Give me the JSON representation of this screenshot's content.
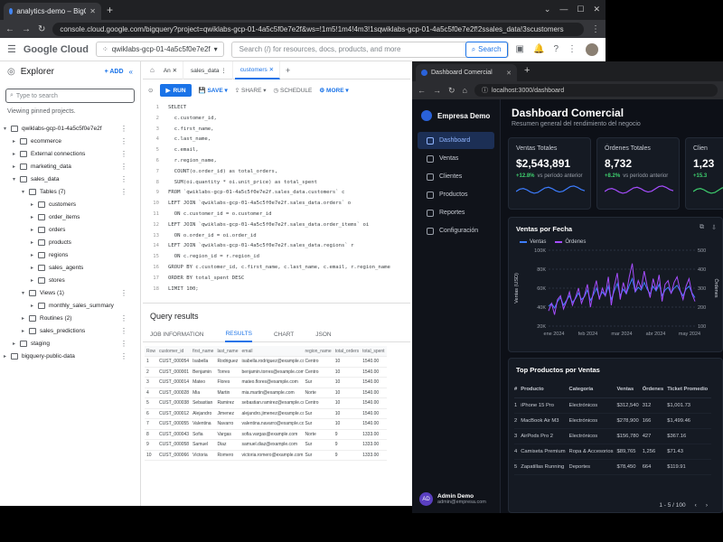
{
  "bq": {
    "tab_title": "analytics-demo – BigQuery – qwikl",
    "url": "console.cloud.google.com/bigquery?project=qwiklabs-gcp-01-4a5c5f0e7e2f&ws=!1m5!1m4!4m3!1sqwiklabs-gcp-01-4a5c5f0e7e2f!2ssales_data!3scustomers",
    "brand": "Google Cloud",
    "project": "qwiklabs-gcp-01-4a5c5f0e7e2f",
    "search_placeholder": "Search (/) for resources, docs, products, and more",
    "search_button": "Search",
    "explorer": {
      "title": "Explorer",
      "add": "+ ADD",
      "search_placeholder": "Type to search",
      "pinned": "Viewing pinned projects.",
      "tree": [
        {
          "label": "qwiklabs-gcp-01-4a5c5f0e7e2f",
          "indent": 0,
          "arrow": "▾"
        },
        {
          "label": "ecommerce",
          "indent": 1,
          "arrow": "▸"
        },
        {
          "label": "External connections",
          "indent": 1,
          "arrow": "▸"
        },
        {
          "label": "marketing_data",
          "indent": 1,
          "arrow": "▸"
        },
        {
          "label": "sales_data",
          "indent": 1,
          "arrow": "▾"
        },
        {
          "label": "Tables (7)",
          "indent": 2,
          "arrow": "▾"
        },
        {
          "label": "customers",
          "indent": 3,
          "arrow": "▸"
        },
        {
          "label": "order_items",
          "indent": 3,
          "arrow": "▸"
        },
        {
          "label": "orders",
          "indent": 3,
          "arrow": "▸"
        },
        {
          "label": "products",
          "indent": 3,
          "arrow": "▸"
        },
        {
          "label": "regions",
          "indent": 3,
          "arrow": "▸"
        },
        {
          "label": "sales_agents",
          "indent": 3,
          "arrow": "▸"
        },
        {
          "label": "stores",
          "indent": 3,
          "arrow": "▸"
        },
        {
          "label": "Views (1)",
          "indent": 2,
          "arrow": "▾"
        },
        {
          "label": "monthly_sales_summary",
          "indent": 3,
          "arrow": "▸"
        },
        {
          "label": "Routines (2)",
          "indent": 2,
          "arrow": "▸"
        },
        {
          "label": "sales_predictions",
          "indent": 2,
          "arrow": "▸"
        },
        {
          "label": "staging",
          "indent": 1,
          "arrow": "▸"
        },
        {
          "label": "bigquery-public-data",
          "indent": 0,
          "arrow": "▸"
        }
      ]
    },
    "editor_tabs": [
      {
        "label": "An ✕",
        "active": false
      },
      {
        "label": "sales_data ⋮",
        "active": false
      },
      {
        "label": "customers ✕",
        "active": true
      }
    ],
    "toolbar": {
      "run": "RUN",
      "save": "SAVE",
      "share": "SHARE",
      "schedule": "SCHEDULE",
      "more": "MORE"
    },
    "code_lines": [
      "SELECT",
      "  c.customer_id,",
      "  c.first_name,",
      "  c.last_name,",
      "  c.email,",
      "  r.region_name,",
      "  COUNT(o.order_id) as total_orders,",
      "  SUM(oi.quantity * oi.unit_price) as total_spent",
      "FROM `qwiklabs-gcp-01-4a5c5f0e7e2f.sales_data.customers` c",
      "LEFT JOIN `qwiklabs-gcp-01-4a5c5f0e7e2f.sales_data.orders` o",
      "  ON c.customer_id = o.customer_id",
      "LEFT JOIN `qwiklabs-gcp-01-4a5c5f0e7e2f.sales_data.order_items` oi",
      "  ON o.order_id = oi.order_id",
      "LEFT JOIN `qwiklabs-gcp-01-4a5c5f0e7e2f.sales_data.regions` r",
      "  ON c.region_id = r.region_id",
      "GROUP BY c.customer_id, c.first_name, c.last_name, c.email, r.region_name",
      "ORDER BY total_spent DESC",
      "LIMIT 100;"
    ],
    "results": {
      "title": "Query results",
      "tabs": [
        "JOB INFORMATION",
        "RESULTS",
        "CHART",
        "JSON"
      ],
      "active_tab": 1,
      "columns": [
        "Row",
        "customer_id",
        "first_name",
        "last_name",
        "email",
        "region_name",
        "total_orders",
        "total_spent"
      ],
      "rows": [
        [
          "1",
          "CUST_000054",
          "Isabella",
          "Rodriguez",
          "isabella.rodriguez@example.com",
          "Centro",
          "10",
          "1540.00"
        ],
        [
          "2",
          "CUST_000001",
          "Benjamin",
          "Torres",
          "benjamin.torres@example.com",
          "Centro",
          "10",
          "1540.00"
        ],
        [
          "3",
          "CUST_000014",
          "Mateo",
          "Flores",
          "mateo.flores@example.com",
          "Sur",
          "10",
          "1540.00"
        ],
        [
          "4",
          "CUST_000028",
          "Mia",
          "Martin",
          "mia.martin@example.com",
          "Norte",
          "10",
          "1540.00"
        ],
        [
          "5",
          "CUST_000038",
          "Sebastian",
          "Ramirez",
          "sebastian.ramirez@example.com",
          "Centro",
          "10",
          "1540.00"
        ],
        [
          "6",
          "CUST_000012",
          "Alejandro",
          "Jimenez",
          "alejandro.jimenez@example.com",
          "Sur",
          "10",
          "1540.00"
        ],
        [
          "7",
          "CUST_000055",
          "Valentina",
          "Navarro",
          "valentina.navarro@example.com",
          "Sur",
          "10",
          "1540.00"
        ],
        [
          "8",
          "CUST_000043",
          "Sofia",
          "Vargas",
          "sofia.vargas@example.com",
          "Norte",
          "9",
          "1333.00"
        ],
        [
          "9",
          "CUST_000058",
          "Samuel",
          "Diaz",
          "samuel.diaz@example.com",
          "Sur",
          "9",
          "1333.00"
        ],
        [
          "10",
          "CUST_000066",
          "Victoria",
          "Romero",
          "victoria.romero@example.com",
          "Sur",
          "9",
          "1333.00"
        ]
      ]
    }
  },
  "dash": {
    "tab_title": "Dashboard Comercial",
    "url": "localhost:3000/dashboard",
    "brand": "Empresa Demo",
    "nav": [
      "Dashboard",
      "Ventas",
      "Clientes",
      "Productos",
      "Reportes",
      "Configuración"
    ],
    "active_nav": 0,
    "user_initials": "AD",
    "user_name": "Admin Demo",
    "user_email": "admin@empresa.com",
    "title": "Dashboard Comercial",
    "subtitle": "Resumen general del rendimiento del negocio",
    "kpis": [
      {
        "label": "Ventas Totales",
        "value": "$2,543,891",
        "change": "+12.8%",
        "suffix": "vs período anterior",
        "color": "#3d7dff"
      },
      {
        "label": "Órdenes Totales",
        "value": "8,732",
        "change": "+8.2%",
        "suffix": "vs período anterior",
        "color": "#a64dff"
      },
      {
        "label": "Clien",
        "value": "1,23",
        "change": "+15.3",
        "suffix": "",
        "color": "#3ecf6e"
      }
    ],
    "chart_title": "Ventas por Fecha",
    "top_title": "Top Productos por Ventas",
    "top_columns": [
      "#",
      "Producto",
      "Categoría",
      "Ventas",
      "Órdenes",
      "Ticket Promedio"
    ],
    "top_rows": [
      [
        "1",
        "iPhone 15 Pro",
        "Electrónicos",
        "$312,540",
        "312",
        "$1,001.73"
      ],
      [
        "2",
        "MacBook Air M3",
        "Electrónicos",
        "$278,900",
        "166",
        "$1,499.46"
      ],
      [
        "3",
        "AirPods Pro 2",
        "Electrónicos",
        "$156,780",
        "427",
        "$367.16"
      ],
      [
        "4",
        "Camiseta Premium",
        "Ropa & Accesorios",
        "$89,765",
        "1,256",
        "$71.43"
      ],
      [
        "5",
        "Zapatillas Running",
        "Deportes",
        "$78,450",
        "664",
        "$119.91"
      ]
    ],
    "pagination": "1 - 5 / 100"
  },
  "chart_data": {
    "type": "line",
    "title": "Ventas por Fecha",
    "x_ticks": [
      "ene 2024",
      "feb 2024",
      "mar 2024",
      "abr 2024",
      "may 2024"
    ],
    "y_left_ticks": [
      "100K",
      "80K",
      "60K",
      "40K",
      "20K"
    ],
    "y_right_ticks": [
      "500",
      "400",
      "300",
      "200",
      "100"
    ],
    "ylabel": "Ventas (USD)",
    "y2label": "Órdenes",
    "ylim": [
      20000,
      100000
    ],
    "y2lim": [
      100,
      500
    ],
    "series": [
      {
        "name": "Ventas",
        "color": "#3d7dff",
        "axis": "left",
        "values": [
          41000,
          44000,
          39000,
          46000,
          50000,
          42000,
          47000,
          52000,
          45000,
          49000,
          55000,
          48000,
          51000,
          58000,
          47000,
          53000,
          60000,
          50000,
          56000,
          52000,
          62000,
          48000,
          57000,
          65000,
          52000,
          59000,
          54000,
          63000,
          70000,
          56000,
          61000,
          58000,
          66000,
          59000,
          54000,
          62000,
          57000,
          64000,
          52000,
          58000,
          61000,
          55000,
          60000,
          63000,
          57000,
          52000,
          59000,
          62000,
          55000,
          50000
        ]
      },
      {
        "name": "Órdenes",
        "color": "#a64dff",
        "axis": "right",
        "values": [
          180,
          220,
          160,
          240,
          260,
          190,
          230,
          280,
          210,
          250,
          300,
          220,
          260,
          320,
          200,
          280,
          340,
          240,
          300,
          260,
          360,
          210,
          310,
          380,
          240,
          330,
          270,
          360,
          430,
          280,
          340,
          300,
          390,
          310,
          250,
          350,
          290,
          370,
          230,
          320,
          340,
          270,
          330,
          360,
          290,
          240,
          310,
          350,
          270,
          230
        ]
      }
    ]
  }
}
